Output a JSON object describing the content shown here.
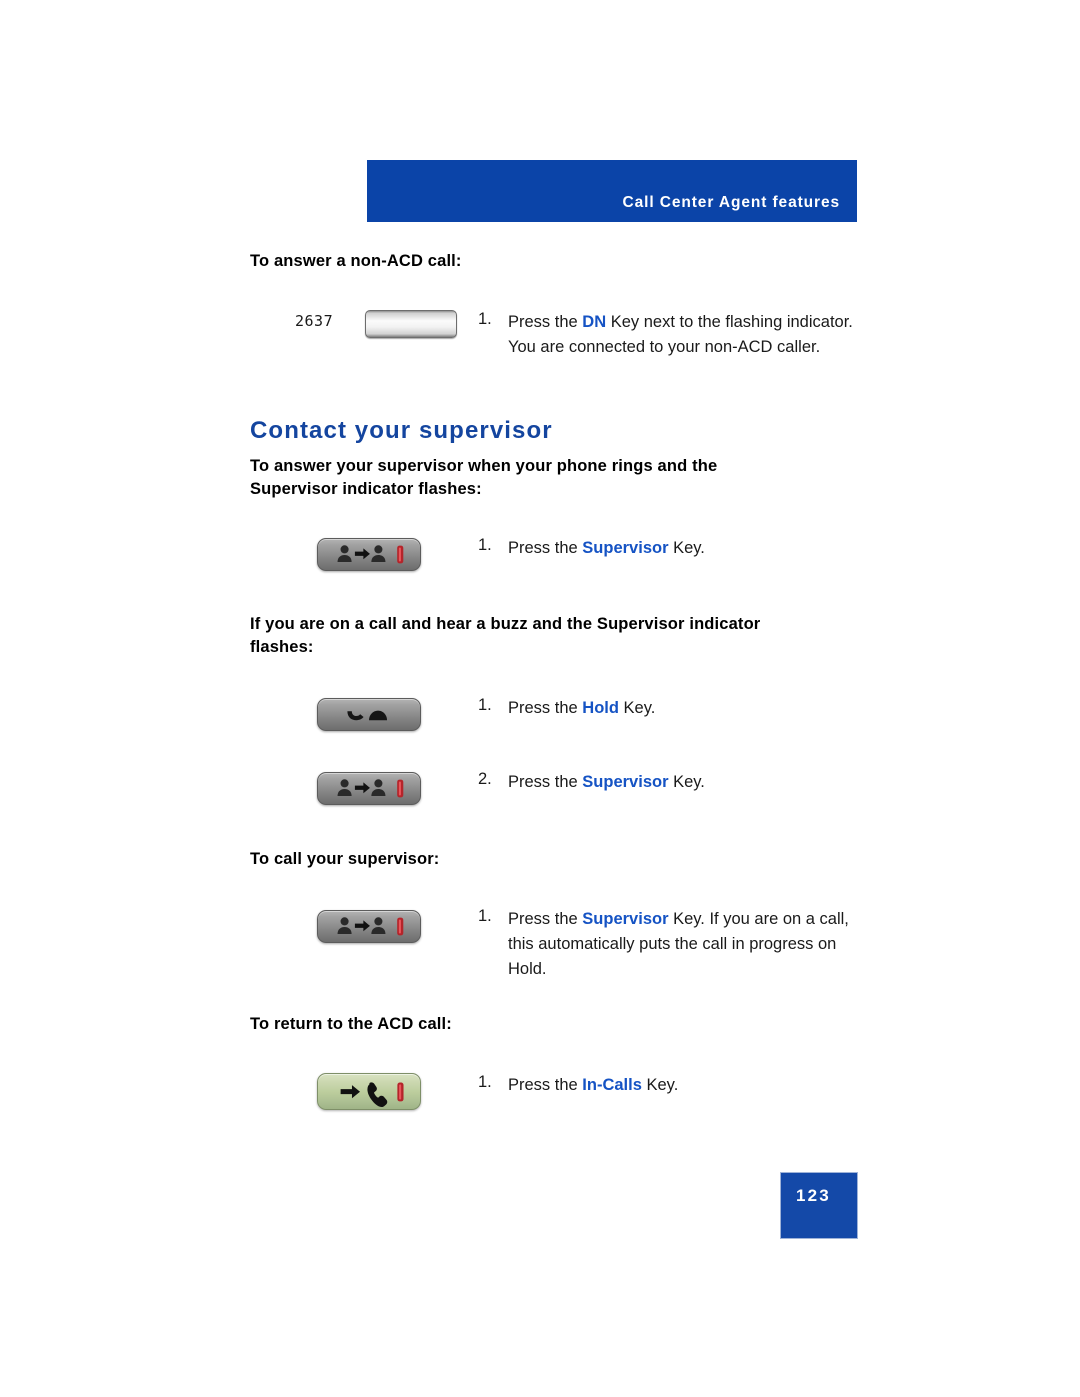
{
  "header": {
    "title": "Call Center Agent features"
  },
  "blocks": {
    "answer_non_acd_heading": "To answer a non-ACD call:",
    "dn_label": "2637",
    "section_title": "Contact your supervisor",
    "answer_supervisor_heading": "To answer your supervisor when your phone rings and the Supervisor indicator flashes:",
    "buzz_heading": "If you are on a call and hear a buzz and the Supervisor indicator flashes:",
    "call_supervisor_heading": "To call your supervisor:",
    "return_acd_heading": "To return to the ACD call:"
  },
  "steps": {
    "non_acd": {
      "num": "1.",
      "pre": "Press the ",
      "key": "DN",
      "post": " Key next to the flashing indicator. You are connected to your non-ACD caller."
    },
    "answer_supervisor": {
      "num": "1.",
      "pre": "Press the ",
      "key": "Supervisor",
      "post": " Key."
    },
    "buzz_hold": {
      "num": "1.",
      "pre": "Press the ",
      "key": "Hold",
      "post": " Key."
    },
    "buzz_supervisor": {
      "num": "2.",
      "pre": "Press the ",
      "key": "Supervisor",
      "post": " Key."
    },
    "call_supervisor": {
      "num": "1.",
      "pre": "Press the ",
      "key": "Supervisor",
      "post": " Key. If you are on a call, this automatically puts the call in progress on Hold."
    },
    "return_acd": {
      "num": "1.",
      "pre": "Press the ",
      "key": "In-Calls",
      "post": " Key."
    }
  },
  "footer": {
    "page_number": "123"
  },
  "colors": {
    "header_blue": "#0B44A8",
    "heading_blue": "#14459F",
    "keyword_blue": "#1553C4",
    "page_box_blue": "#1449A8",
    "led_red": "#C0272D"
  },
  "keys": {
    "dn": "dn-key",
    "supervisor": "supervisor-key",
    "hold": "hold-key",
    "in_calls": "in-calls-key"
  }
}
